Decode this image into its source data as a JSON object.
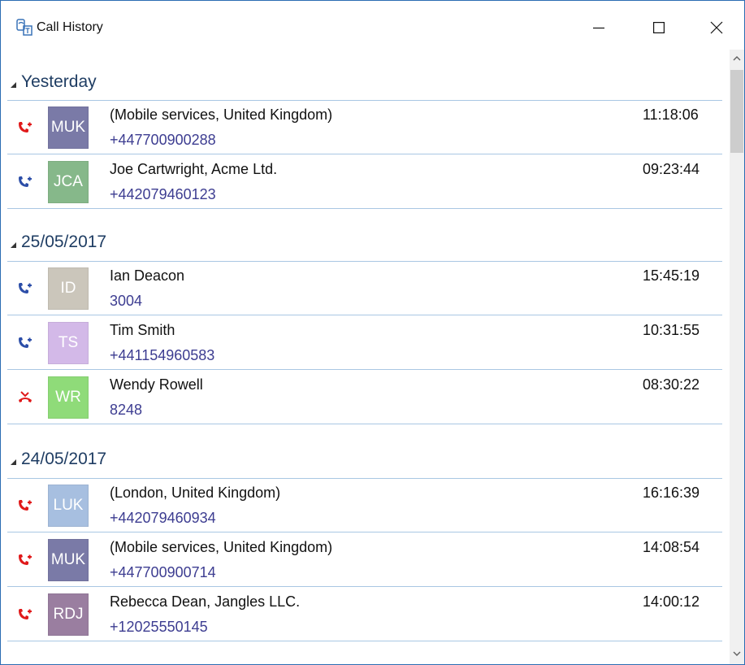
{
  "window": {
    "title": "Call History"
  },
  "groups": [
    {
      "label": "Yesterday",
      "calls": [
        {
          "name": "(Mobile services, United Kingdom)",
          "number": "+447700900288",
          "time": "11:18:06",
          "initials": "MUK",
          "avatar_color": "#7a7aa7",
          "call_type": "incoming-missed",
          "icon_color": "#e0191a"
        },
        {
          "name": "Joe Cartwright, Acme Ltd.",
          "number": "+442079460123",
          "time": "09:23:44",
          "initials": "JCA",
          "avatar_color": "#86b88a",
          "call_type": "incoming",
          "icon_color": "#2c4ea8"
        }
      ]
    },
    {
      "label": "25/05/2017",
      "calls": [
        {
          "name": "Ian Deacon",
          "number": "3004",
          "time": "15:45:19",
          "initials": "ID",
          "avatar_color": "#cbc6bb",
          "call_type": "incoming",
          "icon_color": "#2c4ea8"
        },
        {
          "name": "Tim Smith",
          "number": "+441154960583",
          "time": "10:31:55",
          "initials": "TS",
          "avatar_color": "#d3b9e8",
          "call_type": "incoming",
          "icon_color": "#2c4ea8"
        },
        {
          "name": "Wendy Rowell",
          "number": "8248",
          "time": "08:30:22",
          "initials": "WR",
          "avatar_color": "#8fdb79",
          "call_type": "rejected",
          "icon_color": "#e0191a"
        }
      ]
    },
    {
      "label": "24/05/2017",
      "calls": [
        {
          "name": "(London, United Kingdom)",
          "number": "+442079460934",
          "time": "16:16:39",
          "initials": "LUK",
          "avatar_color": "#a7bfe0",
          "call_type": "incoming-missed",
          "icon_color": "#e0191a"
        },
        {
          "name": "(Mobile services, United Kingdom)",
          "number": "+447700900714",
          "time": "14:08:54",
          "initials": "MUK",
          "avatar_color": "#7a7aa7",
          "call_type": "incoming-missed",
          "icon_color": "#e0191a"
        },
        {
          "name": "Rebecca Dean, Jangles LLC.",
          "number": "+12025550145",
          "time": "14:00:12",
          "initials": "RDJ",
          "avatar_color": "#9a7ea0",
          "call_type": "incoming-missed",
          "icon_color": "#e0191a"
        }
      ]
    }
  ],
  "icons": {
    "app": "call-history-app-icon",
    "minimize": "minimize-icon",
    "maximize": "maximize-icon",
    "close": "close-icon",
    "scroll_up": "chevron-up-icon",
    "scroll_down": "chevron-down-icon"
  }
}
